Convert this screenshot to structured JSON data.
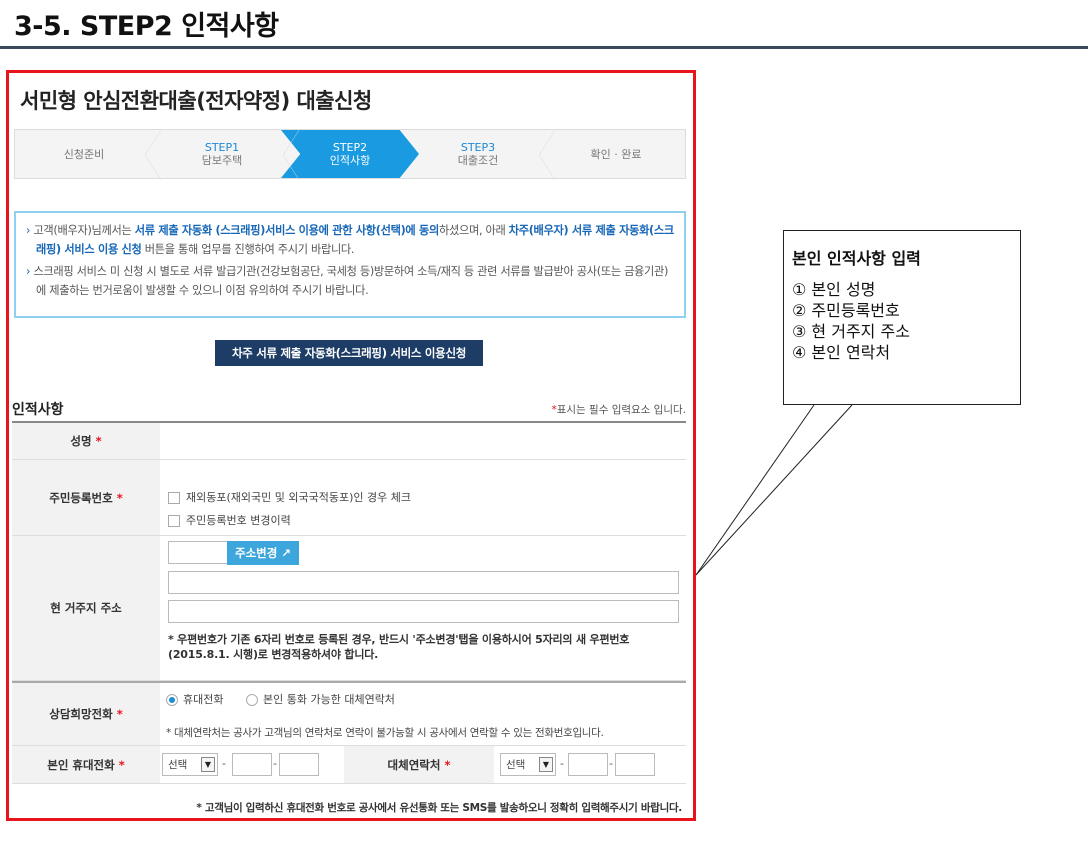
{
  "slide": {
    "title": "3-5. STEP2 인적사항"
  },
  "page": {
    "heading": "서민형 안심전환대출(전자약정) 대출신청"
  },
  "steps": [
    {
      "num": "",
      "label": "신청준비"
    },
    {
      "num": "STEP1",
      "label": "담보주택"
    },
    {
      "num": "STEP2",
      "label": "인적사항"
    },
    {
      "num": "STEP3",
      "label": "대출조건"
    },
    {
      "num": "",
      "label": "확인 · 완료"
    }
  ],
  "notice": {
    "p1_a": "고객(배우자)님께서는 ",
    "p1_hl1": "서류 제출 자동화 (스크래핑)서비스 이용에 관한 사항(선택)에 동의",
    "p1_b": "하셨으며, 아래 ",
    "p1_hl2": "차주(배우자) 서류 제출 자동화(스크래핑) 서비스 이용 신청",
    "p1_c": " 버튼을 통해 업무를 진행하여 주시기 바랍니다.",
    "p2": "스크래핑 서비스 미 신청 시 별도로 서류 발급기관(건강보험공단, 국세청 등)방문하여 소득/재직 등 관련 서류를 발급받아 공사(또는 금융기관)에 제출하는 번거로움이 발생할 수 있으니 이점 유의하여 주시기 바랍니다."
  },
  "scrape_button": "차주 서류 제출 자동화(스크래핑) 서비스 이용신청",
  "section": {
    "title": "인적사항",
    "star": "*",
    "req_note": "표시는 필수 입력요소 입니다."
  },
  "form": {
    "name_label": "성명",
    "rrn_label": "주민등록번호",
    "rrn_opt1": "재외동포(재외국민 및 외국국적동포)인 경우 체크",
    "rrn_opt2": "주민등록번호 변경이력",
    "addr_label": "현 거주지 주소",
    "addr_button": "주소변경 ↗",
    "addr_note": "* 우편번호가 기존 6자리 번호로 등록된 경우, 반드시 '주소변경'탭을 이용하시어 5자리의 새 우편번호(2015.8.1. 시행)로 변경적용하셔야 합니다.",
    "phone_pref_label": "상담희망전화",
    "radio_mobile": "휴대전화",
    "radio_alt": "본인 통화 가능한 대체연락처",
    "alt_note": "* 대체연락처는 공사가 고객님의 연락처로 연락이 불가능할 시 공사에서 연락할 수 있는 전화번호입니다.",
    "mobile_label": "본인 휴대전화",
    "alt_label": "대체연락처",
    "select_placeholder": "선택",
    "dash": "-",
    "bottom_note": "* 고객님이 입력하신 휴대전화 번호로 공사에서 유선통화 또는 SMS를 발송하오니 정확히 입력해주시기 바랍니다."
  },
  "callout": {
    "title": "본인 인적사항 입력",
    "items": [
      "① 본인 성명",
      "② 주민등록번호",
      "③ 현 거주지 주소",
      "④ 본인 연락처"
    ]
  },
  "colors": {
    "frame": "#e8141b",
    "active_step": "#1a9ae0",
    "scrape_button": "#1d3d66",
    "addr_button": "#3da7dd"
  }
}
